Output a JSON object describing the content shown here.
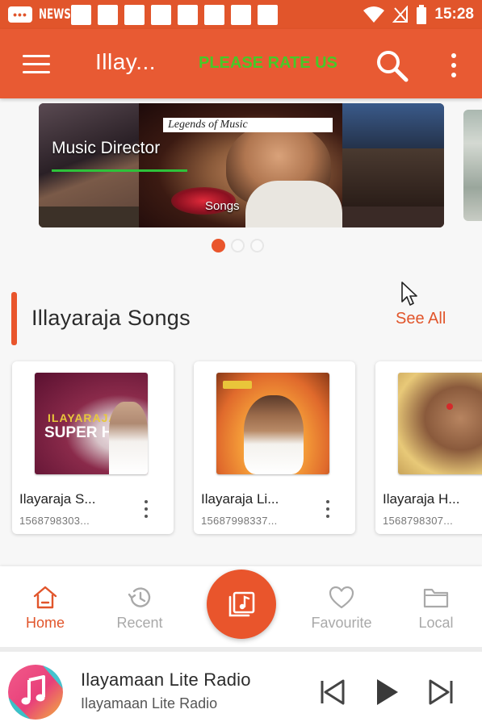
{
  "status_bar": {
    "notification_text": "NEWS",
    "time": "15:28"
  },
  "app_bar": {
    "title": "Illay...",
    "rate_label": "PLEASE RATE US",
    "icons": [
      "menu-icon",
      "search-icon",
      "more-vert-icon"
    ]
  },
  "carousel": {
    "banner": {
      "tag": "Legends of Music",
      "heading": "Music Director",
      "caption": "Songs"
    },
    "page_count": 3,
    "active_page": 1
  },
  "section": {
    "title": "Illayaraja Songs",
    "see_all": "See All"
  },
  "songs": [
    {
      "name": "Ilayaraja S...",
      "id": "1568798303...",
      "art_text_top": "ILAYARAJA",
      "art_text_main": "SUPER HIT"
    },
    {
      "name": "Ilayaraja Li...",
      "id": "15687998337..."
    },
    {
      "name": "Ilayaraja H...",
      "id": "1568798307..."
    }
  ],
  "bottom_nav": {
    "items": [
      {
        "label": "Home",
        "icon": "home-icon",
        "active": true
      },
      {
        "label": "Recent",
        "icon": "history-icon",
        "active": false
      },
      {
        "label": "Favourite",
        "icon": "heart-icon",
        "active": false
      },
      {
        "label": "Local",
        "icon": "folder-icon",
        "active": false
      }
    ],
    "center_button_icon": "music-library-icon"
  },
  "player": {
    "title": "Ilayamaan Lite Radio",
    "subtitle": "Ilayamaan Lite Radio",
    "controls": [
      "skip-previous-icon",
      "play-icon",
      "skip-next-icon"
    ]
  },
  "colors": {
    "primary": "#e85a33",
    "accent_green": "#46c928",
    "inactive": "#a9a9a9"
  }
}
